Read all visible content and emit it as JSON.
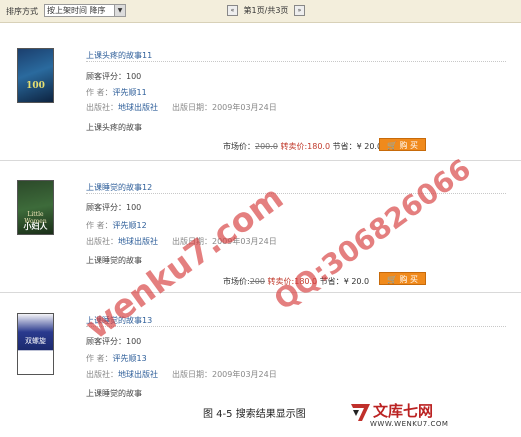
{
  "toolbar": {
    "sort_label": "排序方式",
    "sort_value": "按上架时间 降序",
    "page_text": "第1页/共3页"
  },
  "books": [
    {
      "title": "上课头疼的故事11",
      "rating_label": "顾客评分：",
      "rating": "100",
      "author_label": "作 者：",
      "author": "评先顺11",
      "publisher_label": "出版社：",
      "publisher": "地球出版社",
      "date_label": "出版日期：",
      "date": "2009年03月24日",
      "desc": "上课头疼的故事",
      "market_label": "市场价：",
      "market_price": "200.0",
      "sale_label": "转卖价:",
      "sale_price": "180.0",
      "save_label": "节省：",
      "save": "¥ 20.0",
      "buy": "购 买",
      "cover_text": "100"
    },
    {
      "title": "上课睡觉的故事12",
      "rating_label": "顾客评分：",
      "rating": "100",
      "author_label": "作 者：",
      "author": "评先顺12",
      "publisher_label": "出版社：",
      "publisher": "地球出版社",
      "date_label": "出版日期：",
      "date": "2009年03月24日",
      "desc": "上课睡觉的故事",
      "market_label": "市场价:",
      "market_price": "200",
      "sale_label": "转卖价:",
      "sale_price": "180.0",
      "save_label": "节省：",
      "save": "¥ 20.0",
      "buy": "购 买",
      "cover_text": "Little Women",
      "cover_sub": "小妇人"
    },
    {
      "title": "上课睡觉的故事13",
      "rating_label": "顾客评分：",
      "rating": "100",
      "author_label": "作 者：",
      "author": "评先顺13",
      "publisher_label": "出版社：",
      "publisher": "地球出版社",
      "date_label": "出版日期：",
      "date": "2009年03月24日",
      "desc": "上课睡觉的故事",
      "cover_text": "双螺旋"
    }
  ],
  "watermarks": {
    "w1": "wenku7.com",
    "w2": "QQ:306826066"
  },
  "caption": "图 4-5  搜索结果显示图",
  "logo": {
    "name": "文库七网",
    "url": "WWW.WENKU7.COM"
  },
  "colors": {
    "topbar": "#f3eedc",
    "link": "#2f5f9a",
    "buy": "#f08a1c",
    "watermark": "#d63a3a"
  }
}
